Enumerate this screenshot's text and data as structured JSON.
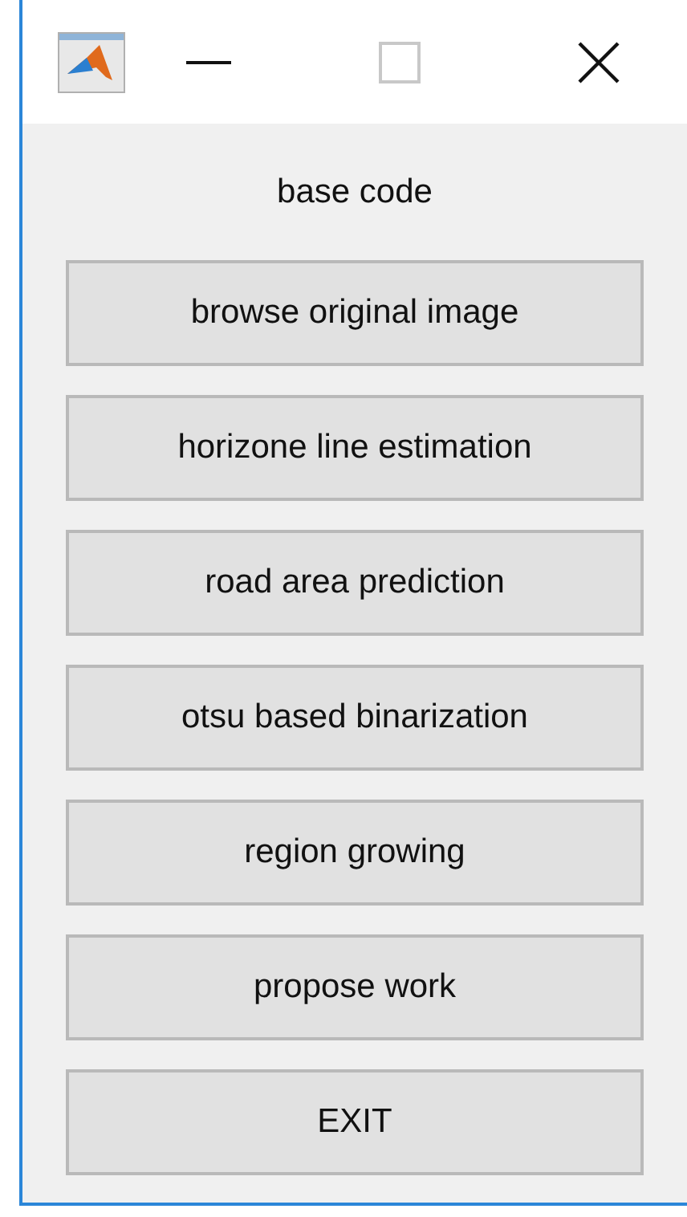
{
  "heading": "base code",
  "buttons": [
    "browse original image",
    "horizone line estimation",
    "road area prediction",
    "otsu based binarization",
    "region growing",
    "propose work",
    "EXIT"
  ]
}
